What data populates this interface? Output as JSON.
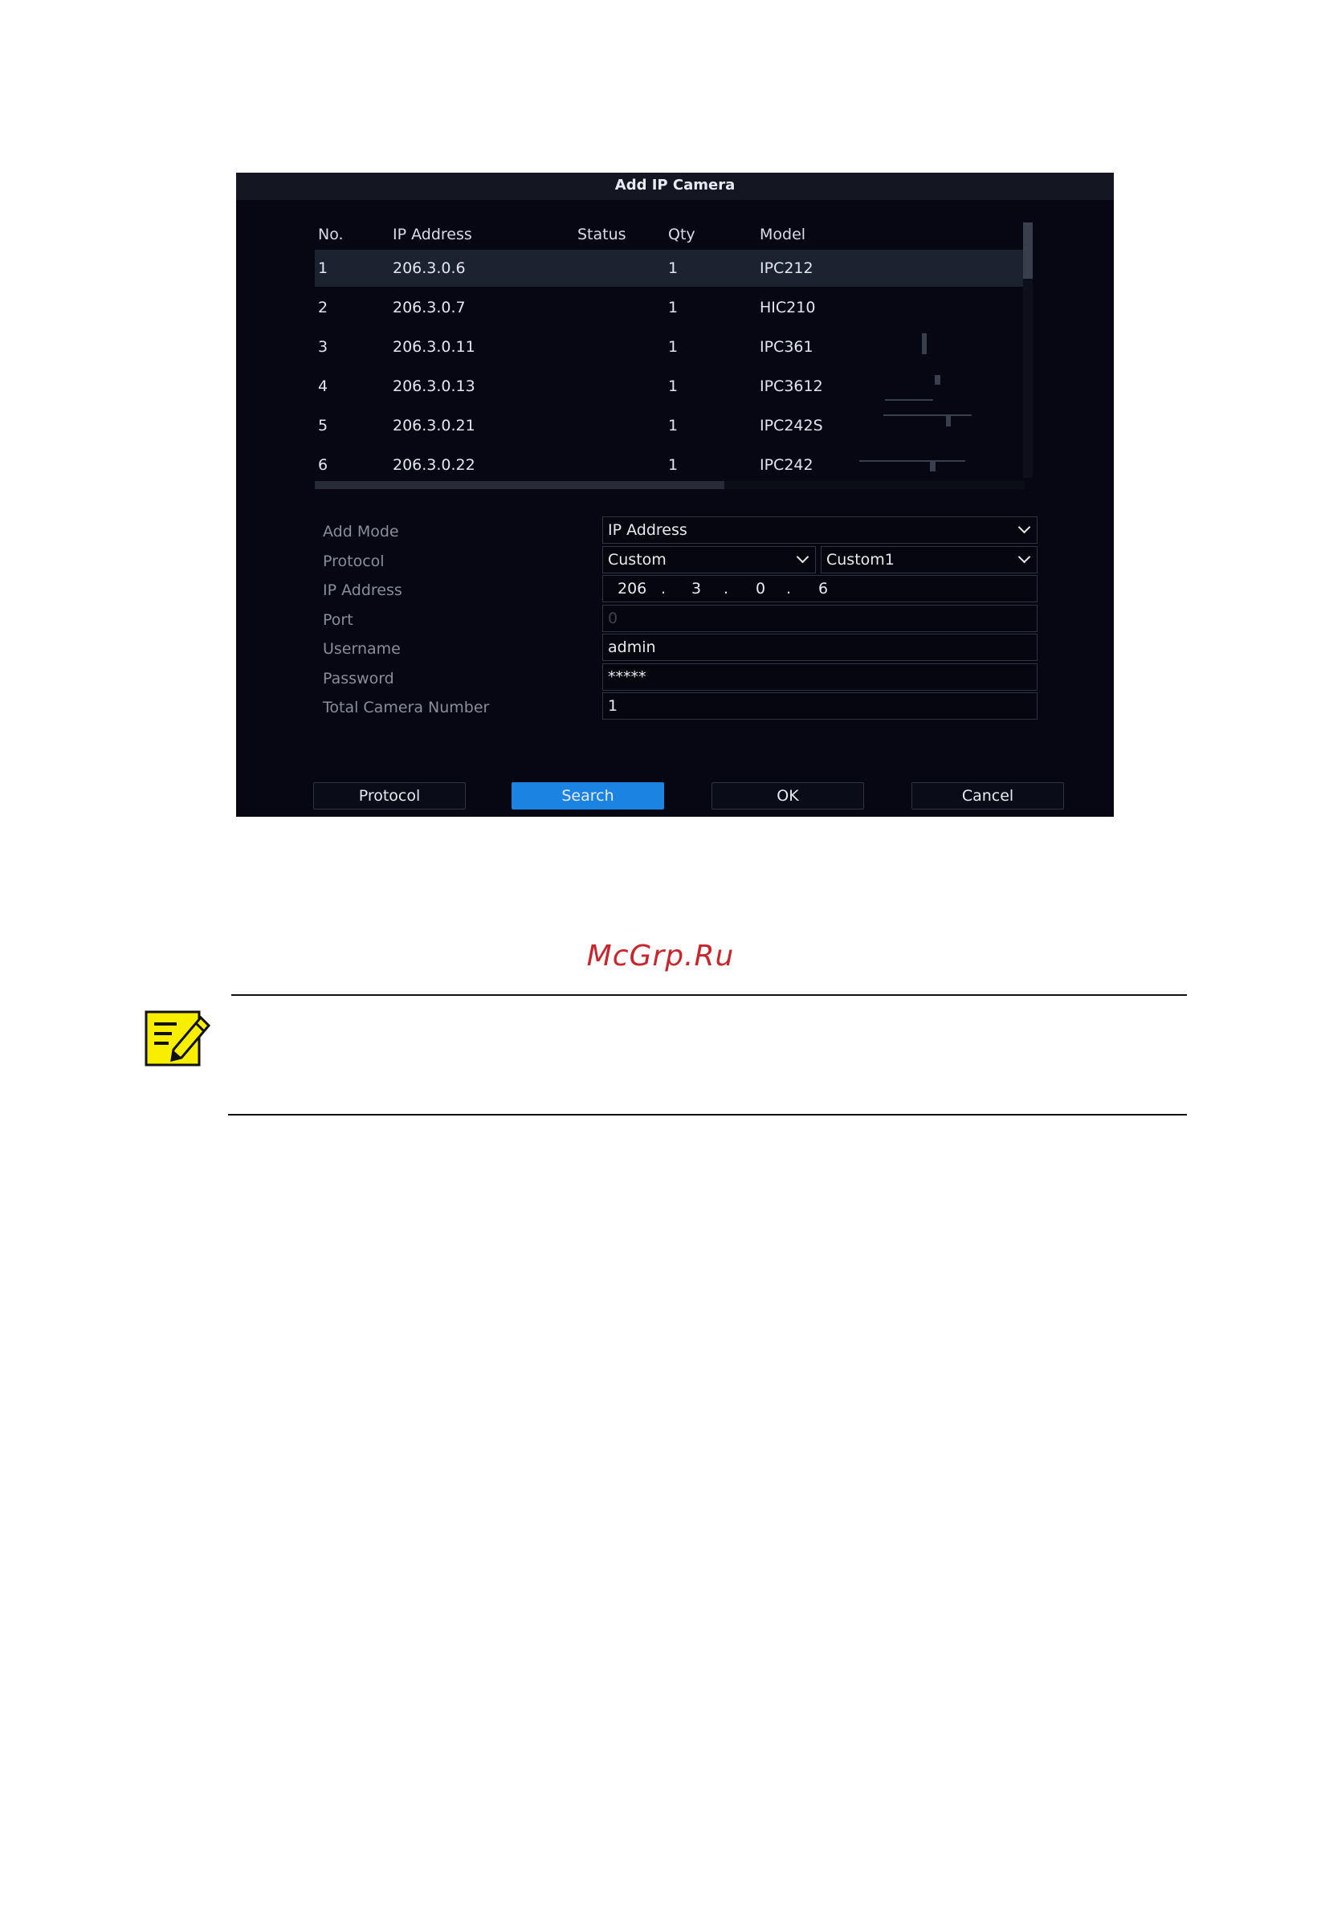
{
  "dialog": {
    "title": "Add IP Camera",
    "columns": [
      "No.",
      "IP Address",
      "Status",
      "Qty",
      "Model"
    ],
    "rows": [
      {
        "no": "1",
        "ip": "206.3.0.6",
        "status": "",
        "qty": "1",
        "model": "IPC212"
      },
      {
        "no": "2",
        "ip": "206.3.0.7",
        "status": "",
        "qty": "1",
        "model": "HIC210"
      },
      {
        "no": "3",
        "ip": "206.3.0.11",
        "status": "",
        "qty": "1",
        "model": "IPC361"
      },
      {
        "no": "4",
        "ip": "206.3.0.13",
        "status": "",
        "qty": "1",
        "model": "IPC3612"
      },
      {
        "no": "5",
        "ip": "206.3.0.21",
        "status": "",
        "qty": "1",
        "model": "IPC242S"
      },
      {
        "no": "6",
        "ip": "206.3.0.22",
        "status": "",
        "qty": "1",
        "model": "IPC242"
      }
    ],
    "form": {
      "add_mode_label": "Add Mode",
      "add_mode_value": "IP Address",
      "protocol_label": "Protocol",
      "protocol_value": "Custom",
      "protocol_sub_value": "Custom1",
      "ip_label": "IP Address",
      "ip_octets": [
        "206",
        "3",
        "0",
        "6"
      ],
      "ip_dot": ".",
      "port_label": "Port",
      "port_value": "0",
      "username_label": "Username",
      "username_value": "admin",
      "password_label": "Password",
      "password_value": "*****",
      "total_label": "Total Camera Number",
      "total_value": "1"
    },
    "buttons": {
      "protocol": "Protocol",
      "search": "Search",
      "ok": "OK",
      "cancel": "Cancel"
    },
    "colors": {
      "background": "#060713",
      "accent": "#1b84e3"
    }
  },
  "page": {
    "watermark": "McGrp.Ru",
    "watermark_color": "#c8262d",
    "note_icon": "note-pencil-icon",
    "note_icon_color": "#f7ee00"
  }
}
